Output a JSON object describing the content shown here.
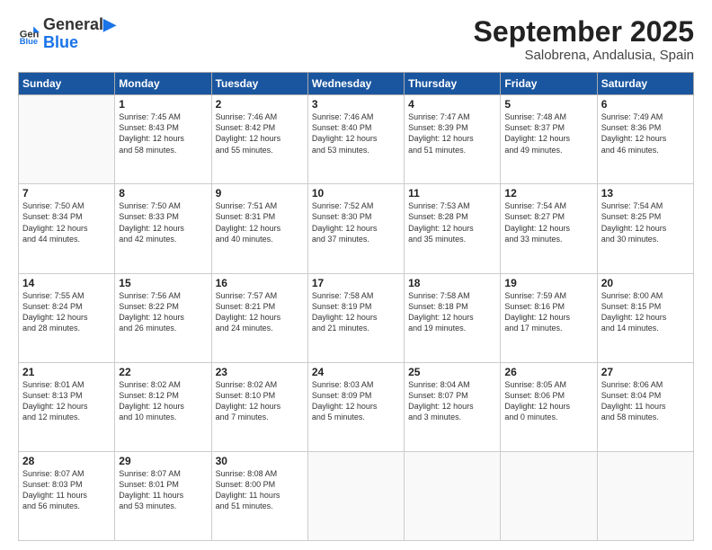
{
  "logo": {
    "line1": "General",
    "line2": "Blue"
  },
  "title": "September 2025",
  "subtitle": "Salobrena, Andalusia, Spain",
  "weekdays": [
    "Sunday",
    "Monday",
    "Tuesday",
    "Wednesday",
    "Thursday",
    "Friday",
    "Saturday"
  ],
  "weeks": [
    [
      {
        "day": "",
        "info": ""
      },
      {
        "day": "1",
        "info": "Sunrise: 7:45 AM\nSunset: 8:43 PM\nDaylight: 12 hours\nand 58 minutes."
      },
      {
        "day": "2",
        "info": "Sunrise: 7:46 AM\nSunset: 8:42 PM\nDaylight: 12 hours\nand 55 minutes."
      },
      {
        "day": "3",
        "info": "Sunrise: 7:46 AM\nSunset: 8:40 PM\nDaylight: 12 hours\nand 53 minutes."
      },
      {
        "day": "4",
        "info": "Sunrise: 7:47 AM\nSunset: 8:39 PM\nDaylight: 12 hours\nand 51 minutes."
      },
      {
        "day": "5",
        "info": "Sunrise: 7:48 AM\nSunset: 8:37 PM\nDaylight: 12 hours\nand 49 minutes."
      },
      {
        "day": "6",
        "info": "Sunrise: 7:49 AM\nSunset: 8:36 PM\nDaylight: 12 hours\nand 46 minutes."
      }
    ],
    [
      {
        "day": "7",
        "info": "Sunrise: 7:50 AM\nSunset: 8:34 PM\nDaylight: 12 hours\nand 44 minutes."
      },
      {
        "day": "8",
        "info": "Sunrise: 7:50 AM\nSunset: 8:33 PM\nDaylight: 12 hours\nand 42 minutes."
      },
      {
        "day": "9",
        "info": "Sunrise: 7:51 AM\nSunset: 8:31 PM\nDaylight: 12 hours\nand 40 minutes."
      },
      {
        "day": "10",
        "info": "Sunrise: 7:52 AM\nSunset: 8:30 PM\nDaylight: 12 hours\nand 37 minutes."
      },
      {
        "day": "11",
        "info": "Sunrise: 7:53 AM\nSunset: 8:28 PM\nDaylight: 12 hours\nand 35 minutes."
      },
      {
        "day": "12",
        "info": "Sunrise: 7:54 AM\nSunset: 8:27 PM\nDaylight: 12 hours\nand 33 minutes."
      },
      {
        "day": "13",
        "info": "Sunrise: 7:54 AM\nSunset: 8:25 PM\nDaylight: 12 hours\nand 30 minutes."
      }
    ],
    [
      {
        "day": "14",
        "info": "Sunrise: 7:55 AM\nSunset: 8:24 PM\nDaylight: 12 hours\nand 28 minutes."
      },
      {
        "day": "15",
        "info": "Sunrise: 7:56 AM\nSunset: 8:22 PM\nDaylight: 12 hours\nand 26 minutes."
      },
      {
        "day": "16",
        "info": "Sunrise: 7:57 AM\nSunset: 8:21 PM\nDaylight: 12 hours\nand 24 minutes."
      },
      {
        "day": "17",
        "info": "Sunrise: 7:58 AM\nSunset: 8:19 PM\nDaylight: 12 hours\nand 21 minutes."
      },
      {
        "day": "18",
        "info": "Sunrise: 7:58 AM\nSunset: 8:18 PM\nDaylight: 12 hours\nand 19 minutes."
      },
      {
        "day": "19",
        "info": "Sunrise: 7:59 AM\nSunset: 8:16 PM\nDaylight: 12 hours\nand 17 minutes."
      },
      {
        "day": "20",
        "info": "Sunrise: 8:00 AM\nSunset: 8:15 PM\nDaylight: 12 hours\nand 14 minutes."
      }
    ],
    [
      {
        "day": "21",
        "info": "Sunrise: 8:01 AM\nSunset: 8:13 PM\nDaylight: 12 hours\nand 12 minutes."
      },
      {
        "day": "22",
        "info": "Sunrise: 8:02 AM\nSunset: 8:12 PM\nDaylight: 12 hours\nand 10 minutes."
      },
      {
        "day": "23",
        "info": "Sunrise: 8:02 AM\nSunset: 8:10 PM\nDaylight: 12 hours\nand 7 minutes."
      },
      {
        "day": "24",
        "info": "Sunrise: 8:03 AM\nSunset: 8:09 PM\nDaylight: 12 hours\nand 5 minutes."
      },
      {
        "day": "25",
        "info": "Sunrise: 8:04 AM\nSunset: 8:07 PM\nDaylight: 12 hours\nand 3 minutes."
      },
      {
        "day": "26",
        "info": "Sunrise: 8:05 AM\nSunset: 8:06 PM\nDaylight: 12 hours\nand 0 minutes."
      },
      {
        "day": "27",
        "info": "Sunrise: 8:06 AM\nSunset: 8:04 PM\nDaylight: 11 hours\nand 58 minutes."
      }
    ],
    [
      {
        "day": "28",
        "info": "Sunrise: 8:07 AM\nSunset: 8:03 PM\nDaylight: 11 hours\nand 56 minutes."
      },
      {
        "day": "29",
        "info": "Sunrise: 8:07 AM\nSunset: 8:01 PM\nDaylight: 11 hours\nand 53 minutes."
      },
      {
        "day": "30",
        "info": "Sunrise: 8:08 AM\nSunset: 8:00 PM\nDaylight: 11 hours\nand 51 minutes."
      },
      {
        "day": "",
        "info": ""
      },
      {
        "day": "",
        "info": ""
      },
      {
        "day": "",
        "info": ""
      },
      {
        "day": "",
        "info": ""
      }
    ]
  ]
}
